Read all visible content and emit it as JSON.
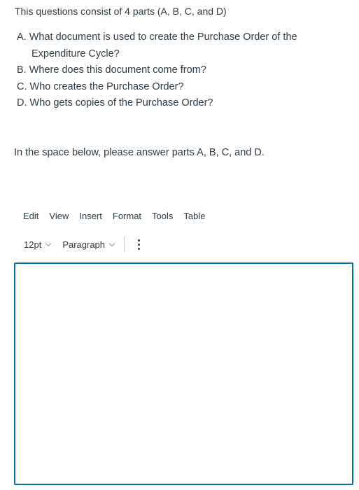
{
  "intro": "This questions consist of 4 parts (A, B, C, and D)",
  "questions": [
    "A. What document is used to create the Purchase Order of the Expenditure Cycle?",
    "B. Where does this document come from?",
    "C. Who creates the Purchase Order?",
    "D. Who gets copies of the Purchase Order?"
  ],
  "answer_prompt": "In the space below, please answer parts A, B, C, and D.",
  "editor": {
    "menu": [
      "Edit",
      "View",
      "Insert",
      "Format",
      "Tools",
      "Table"
    ],
    "font_size": "12pt",
    "block_format": "Paragraph",
    "more_icon": "vertical-ellipsis",
    "content": "",
    "accent_color": "#0770a3"
  }
}
